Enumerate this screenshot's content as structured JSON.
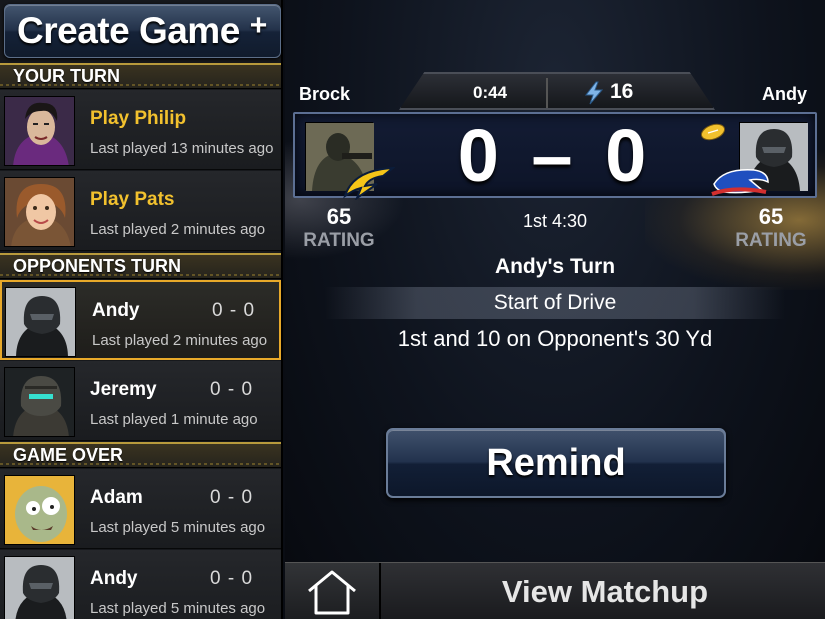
{
  "sidebar": {
    "create_label": "Create Game",
    "create_plus": "+",
    "sections": [
      {
        "label": "YOUR TURN"
      },
      {
        "label": "OPPONENTS TURN"
      },
      {
        "label": "GAME OVER"
      }
    ],
    "your_turn": [
      {
        "name": "Play Philip",
        "last": "Last played 13 minutes ago"
      },
      {
        "name": "Play Pats",
        "last": "Last played 2 minutes ago"
      }
    ],
    "opponents_turn": [
      {
        "name": "Andy",
        "score": "0 - 0",
        "last": "Last played 2 minutes ago"
      },
      {
        "name": "Jeremy",
        "score": "0 - 0",
        "last": "Last played 1 minute ago"
      }
    ],
    "game_over": [
      {
        "name": "Adam",
        "score": "0 - 0",
        "last": "Last played 5 minutes ago"
      },
      {
        "name": "Andy",
        "score": "0 - 0",
        "last": "Last played 5 minutes ago"
      }
    ]
  },
  "matchup": {
    "home_player": "Brock",
    "away_player": "Andy",
    "clock": "0:44",
    "down_icon": "lightning-icon",
    "down_value": "16",
    "score": "0 – 0",
    "home_rating": "65",
    "away_rating": "65",
    "rating_label": "RATING",
    "quarter": "1st 4:30",
    "turn": "Andy's Turn",
    "drive": "Start of Drive",
    "situation": "1st and 10 on Opponent's 30 Yd",
    "remind_label": "Remind",
    "view_label": "View Matchup",
    "home_icon": "home-icon"
  },
  "colors": {
    "accent_gold": "#f2c12e",
    "selected_border": "#e8a92a",
    "button_navy": "#22324d"
  }
}
